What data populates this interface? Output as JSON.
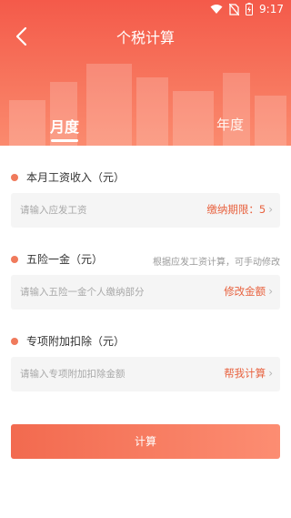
{
  "status_bar": {
    "time": "9:17"
  },
  "header": {
    "title": "个税计算",
    "back_icon": "chevron-left-icon"
  },
  "tabs": [
    {
      "label": "月度",
      "active": true
    },
    {
      "label": "年度",
      "active": false
    }
  ],
  "sections": {
    "income": {
      "label": "本月工资收入（元）",
      "placeholder": "请输入应发工资",
      "action": {
        "prefix": "缴纳期限：",
        "value": "5"
      }
    },
    "insurance": {
      "label": "五险一金（元）",
      "hint": "根据应发工资计算，可手动修改",
      "placeholder": "请输入五险一金个人缴纳部分",
      "action": "修改金额"
    },
    "deduction": {
      "label": "专项附加扣除（元）",
      "placeholder": "请输入专项附加扣除金额",
      "action": "帮我计算"
    }
  },
  "calculate_label": "计算",
  "colors": {
    "accent": "#e8623f",
    "header_start": "#f45a4a",
    "header_end": "#fb8a6e",
    "dot": "#f07a5c"
  }
}
